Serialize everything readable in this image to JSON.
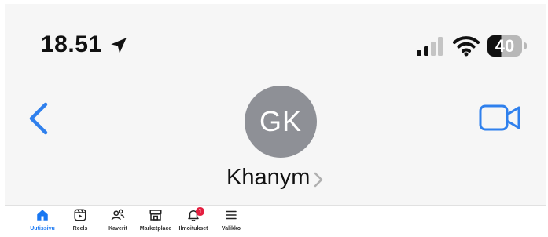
{
  "status_bar": {
    "time": "18.51",
    "battery": "40"
  },
  "header": {
    "avatar_initials": "GK",
    "contact_name": "Khanym"
  },
  "icons": {
    "back": "chevron-left-icon",
    "video": "video-camera-icon",
    "location": "location-arrow-icon",
    "signal": "cellular-signal-icon",
    "wifi": "wifi-icon"
  },
  "colors": {
    "accent": "#1877f2",
    "ios_blue": "#2f80ed",
    "avatar_bg": "#8e9096",
    "badge": "#e41e3f"
  },
  "bottom_nav": {
    "items": [
      {
        "label": "Uutissivu",
        "icon": "home-icon",
        "active": true
      },
      {
        "label": "Reels",
        "icon": "reels-icon"
      },
      {
        "label": "Kaverit",
        "icon": "friends-icon"
      },
      {
        "label": "Marketplace",
        "icon": "marketplace-icon"
      },
      {
        "label": "Ilmoitukset",
        "icon": "bell-icon",
        "badge": "1"
      },
      {
        "label": "Valikko",
        "icon": "menu-icon"
      }
    ]
  }
}
